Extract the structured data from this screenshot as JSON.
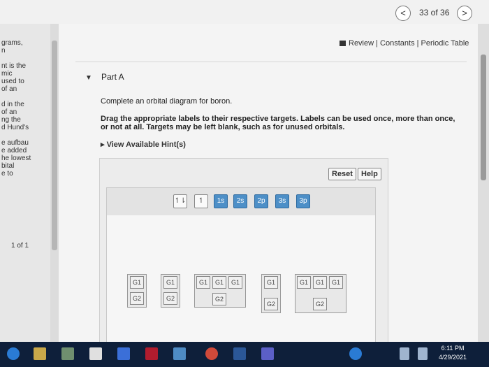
{
  "nav": {
    "prev": "<",
    "next": ">",
    "counter": "33 of 36"
  },
  "side": {
    "lines": [
      "grams,",
      "n",
      "",
      "nt is the",
      "mic",
      "used to",
      "of an",
      "",
      "d in the",
      "of an",
      "ng the",
      "d Hund's",
      "",
      "e aufbau",
      "e added",
      "he lowest",
      "bital",
      "e to"
    ],
    "page": "1 of 1"
  },
  "links": {
    "text": "Review | Constants | Periodic Table"
  },
  "part": {
    "title": "Part A"
  },
  "question": {
    "line1": "Complete an orbital diagram for boron.",
    "line2": "Drag the appropriate labels to their respective targets. Labels can be used once, more than once, or not at all. Targets may be left blank, such as for unused orbitals."
  },
  "hint": {
    "text": "View Available Hint(s)"
  },
  "buttons": {
    "reset": "Reset",
    "help": "Help"
  },
  "labels": [
    "↿⇂",
    "↿",
    "1s",
    "2s",
    "2p",
    "3s",
    "3p"
  ],
  "targets": {
    "g1": "G1",
    "g2": "G2"
  },
  "taskbar": {
    "time": "6:11 PM",
    "date": "4/29/2021"
  }
}
